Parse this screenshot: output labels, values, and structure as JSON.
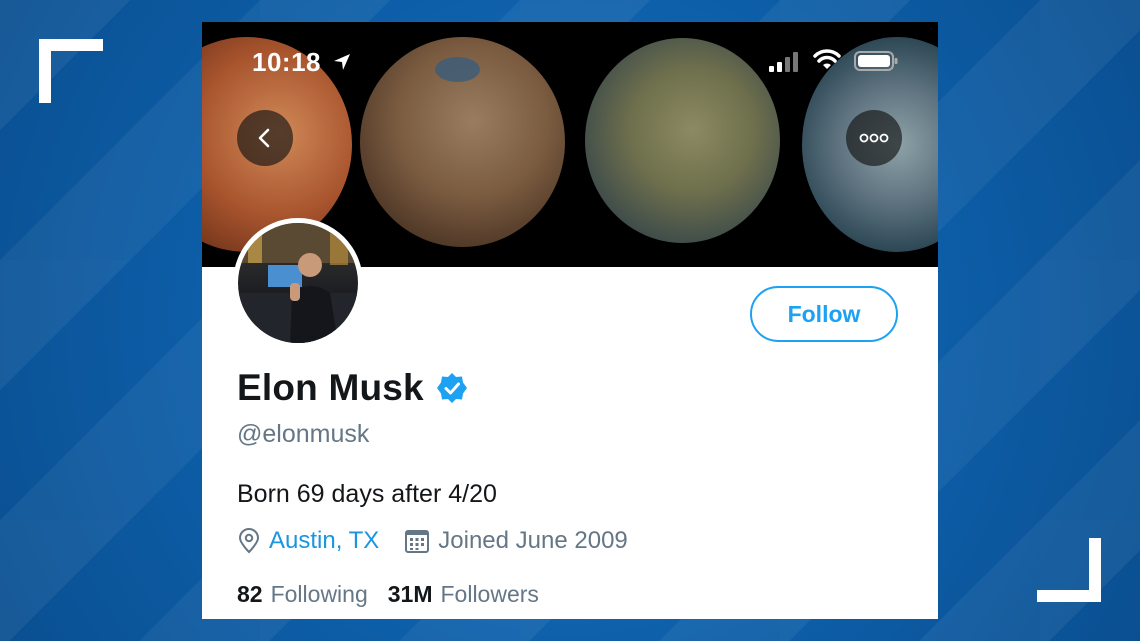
{
  "status_bar": {
    "time": "10:18"
  },
  "profile": {
    "name": "Elon Musk",
    "handle": "@elonmusk",
    "bio": "Born 69 days after 4/20",
    "location": "Austin, TX",
    "joined": "Joined June 2009",
    "following_count": "82",
    "following_label": "Following",
    "followers_count": "31M",
    "followers_label": "Followers"
  },
  "actions": {
    "follow_label": "Follow"
  },
  "icons": {
    "back": "chevron-left-icon",
    "more": "more-horizontal-icon",
    "verified": "verified-badge-icon",
    "location": "location-pin-icon",
    "calendar": "calendar-icon",
    "location_arrow": "location-arrow-icon",
    "signal": "cellular-signal-icon",
    "wifi": "wifi-icon",
    "battery": "battery-icon"
  },
  "colors": {
    "accent": "#1da1f2",
    "link": "#1b95e0",
    "secondary_text": "#657786",
    "primary_text": "#14171a",
    "background": "#0b5aa0"
  }
}
